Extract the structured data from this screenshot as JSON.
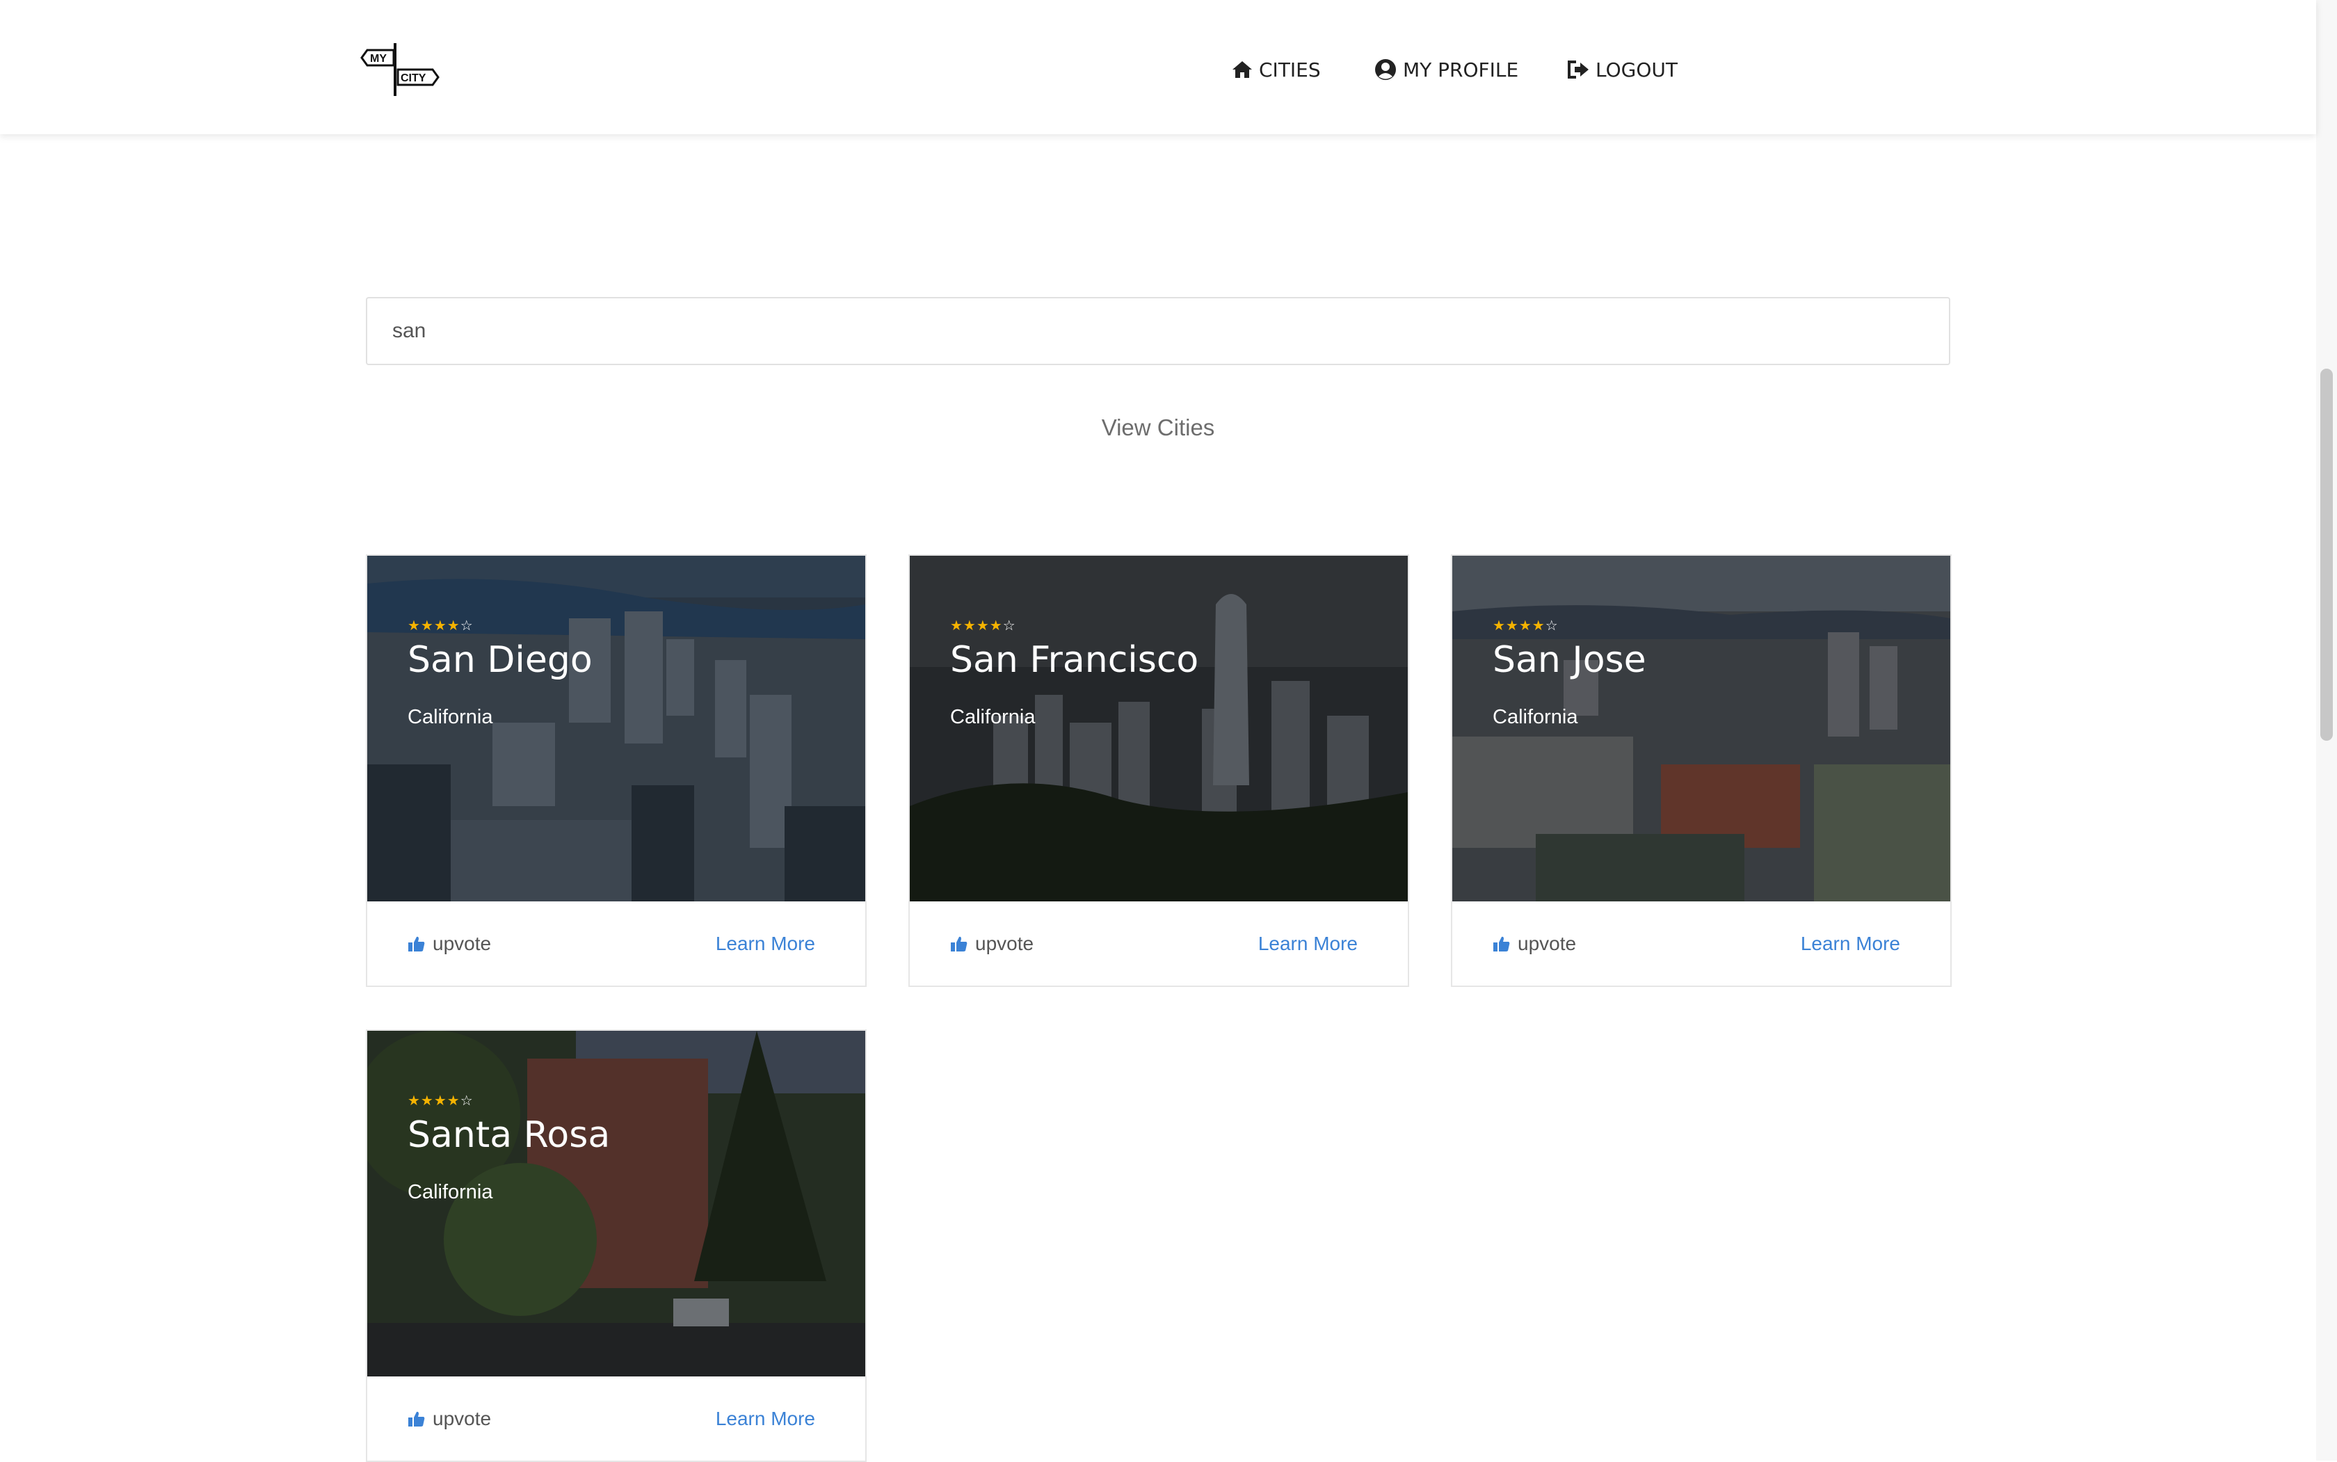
{
  "header": {
    "logo": {
      "line1": "MY",
      "line2": "CITY"
    },
    "nav": [
      {
        "icon": "home-icon",
        "label": "CITIES"
      },
      {
        "icon": "user-circle-icon",
        "label": "MY PROFILE"
      },
      {
        "icon": "sign-out-icon",
        "label": "LOGOUT"
      }
    ]
  },
  "search": {
    "value": "san"
  },
  "section_title": "View Cities",
  "cards": [
    {
      "name": "San Diego",
      "state": "California",
      "rating": 4,
      "rating_max": 5,
      "upvote": "upvote",
      "learn_more": "Learn More"
    },
    {
      "name": "San Francisco",
      "state": "California",
      "rating": 4,
      "rating_max": 5,
      "upvote": "upvote",
      "learn_more": "Learn More"
    },
    {
      "name": "San Jose",
      "state": "California",
      "rating": 4,
      "rating_max": 5,
      "upvote": "upvote",
      "learn_more": "Learn More"
    },
    {
      "name": "Santa Rosa",
      "state": "California",
      "rating": 4,
      "rating_max": 5,
      "upvote": "upvote",
      "learn_more": "Learn More"
    }
  ],
  "colors": {
    "accent": "#3b82d6",
    "star": "#f5b301",
    "text": "#222222"
  }
}
